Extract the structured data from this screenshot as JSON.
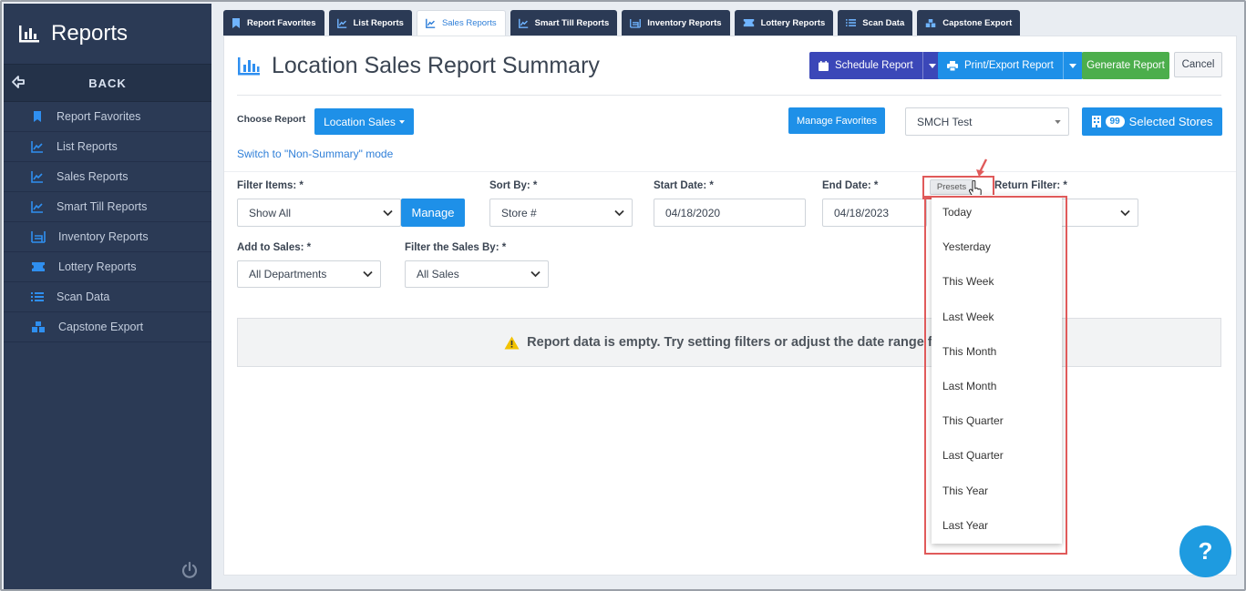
{
  "sidebar": {
    "title": "Reports",
    "back_label": "BACK",
    "items": [
      {
        "label": "Report Favorites"
      },
      {
        "label": "List Reports"
      },
      {
        "label": "Sales Reports"
      },
      {
        "label": "Smart Till Reports"
      },
      {
        "label": "Inventory Reports"
      },
      {
        "label": "Lottery Reports"
      },
      {
        "label": "Scan Data"
      },
      {
        "label": "Capstone Export"
      }
    ]
  },
  "tabs": [
    {
      "label": "Report Favorites"
    },
    {
      "label": "List Reports"
    },
    {
      "label": "Sales Reports",
      "active": true
    },
    {
      "label": "Smart Till Reports"
    },
    {
      "label": "Inventory Reports"
    },
    {
      "label": "Lottery Reports"
    },
    {
      "label": "Scan Data"
    },
    {
      "label": "Capstone Export"
    }
  ],
  "header": {
    "title": "Location Sales Report Summary",
    "schedule_label": "Schedule Report",
    "print_label": "Print/Export Report",
    "generate_label": "Generate Report",
    "cancel_label": "Cancel"
  },
  "choose": {
    "label": "Choose Report",
    "report_value": "Location Sales",
    "manage_favorites_label": "Manage Favorites",
    "store_group_value": "SMCH Test",
    "stores_count": "99",
    "stores_label": "Selected Stores",
    "mode_link": "Switch to \"Non-Summary\" mode"
  },
  "filters": {
    "filter_items_label": "Filter Items: *",
    "filter_items_value": "Show All",
    "manage_label": "Manage",
    "sort_by_label": "Sort By: *",
    "sort_by_value": "Store #",
    "start_date_label": "Start Date: *",
    "start_date_value": "04/18/2020",
    "end_date_label": "End Date: *",
    "end_date_value": "04/18/2023",
    "presets_label": "Presets",
    "return_filter_label": "Return Filter: *",
    "add_to_sales_label": "Add to Sales: *",
    "add_to_sales_value": "All Departments",
    "filter_sales_by_label": "Filter the Sales By: *",
    "filter_sales_by_value": "All Sales"
  },
  "empty_message": "Report data is empty. Try setting filters or adjust the date range for r",
  "presets": [
    "Today",
    "Yesterday",
    "This Week",
    "Last Week",
    "This Month",
    "Last Month",
    "This Quarter",
    "Last Quarter",
    "This Year",
    "Last Year"
  ],
  "help_label": "?",
  "colors": {
    "sidebar": "#2b3a55",
    "primary": "#1e90e8",
    "schedule": "#3b47b8",
    "generate": "#4cae4c",
    "highlight": "#e05a5a"
  }
}
